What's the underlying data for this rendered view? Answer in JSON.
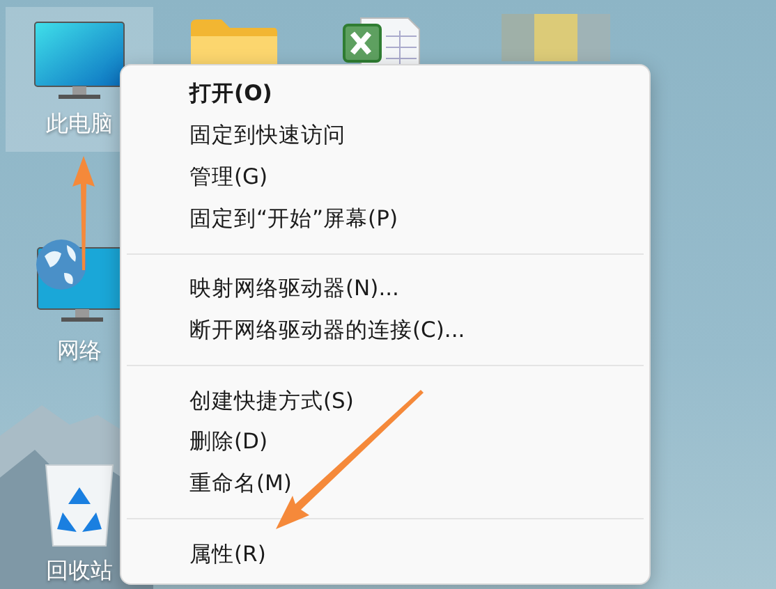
{
  "desktop_icons": [
    {
      "kind": "computer",
      "label": "此电脑",
      "selected": true
    },
    {
      "kind": "network",
      "label": "网络",
      "selected": false
    },
    {
      "kind": "recycle",
      "label": "回收站",
      "selected": false
    }
  ],
  "top_icons": [
    {
      "kind": "folder"
    },
    {
      "kind": "spreadsheet"
    },
    {
      "kind": "blurred"
    }
  ],
  "context_menu": {
    "groups": [
      [
        {
          "label": "打开(O)",
          "bold": true
        },
        {
          "label": "固定到快速访问",
          "bold": false
        },
        {
          "label": "管理(G)",
          "bold": false
        },
        {
          "label": "固定到“开始”屏幕(P)",
          "bold": false
        }
      ],
      [
        {
          "label": "映射网络驱动器(N)...",
          "bold": false
        },
        {
          "label": "断开网络驱动器的连接(C)...",
          "bold": false
        }
      ],
      [
        {
          "label": "创建快捷方式(S)",
          "bold": false
        },
        {
          "label": "删除(D)",
          "bold": false
        },
        {
          "label": "重命名(M)",
          "bold": false
        }
      ],
      [
        {
          "label": "属性(R)",
          "bold": false
        }
      ]
    ]
  }
}
